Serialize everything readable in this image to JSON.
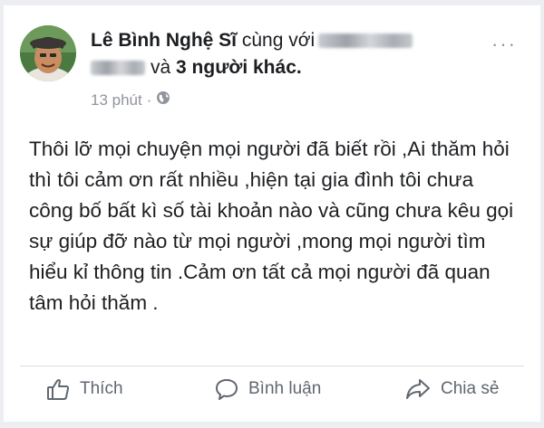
{
  "post": {
    "author": "Lê Bình Nghệ Sĩ",
    "with_text": "cùng với",
    "and_text": "và",
    "others": "3 người khác.",
    "time": "13 phút",
    "separator": "·",
    "privacy_icon": "globe-icon",
    "more_icon": "more-options-icon",
    "more_glyph": "···",
    "body": "Thôi lỡ mọi chuyện mọi người đã biết rồi ,Ai thăm hỏi thì tôi cảm ơn rất nhiều ,hiện tại gia đình tôi chưa công bố bất kì số tài khoản nào và cũng chưa kêu gọi sự giúp đỡ nào từ mọi người ,mong mọi người tìm hiểu kỉ thông tin .Cảm ơn tất cả mọi người đã quan tâm hỏi thăm ."
  },
  "actions": {
    "like": {
      "label": "Thích",
      "icon": "thumbs-up-icon"
    },
    "comment": {
      "label": "Bình luận",
      "icon": "comment-icon"
    },
    "share": {
      "label": "Chia sẻ",
      "icon": "share-icon"
    }
  },
  "colors": {
    "background": "#eceef2",
    "card": "#ffffff",
    "text": "#1c1e21",
    "muted": "#90949c",
    "action_text": "#606770",
    "divider": "#dadde1"
  }
}
